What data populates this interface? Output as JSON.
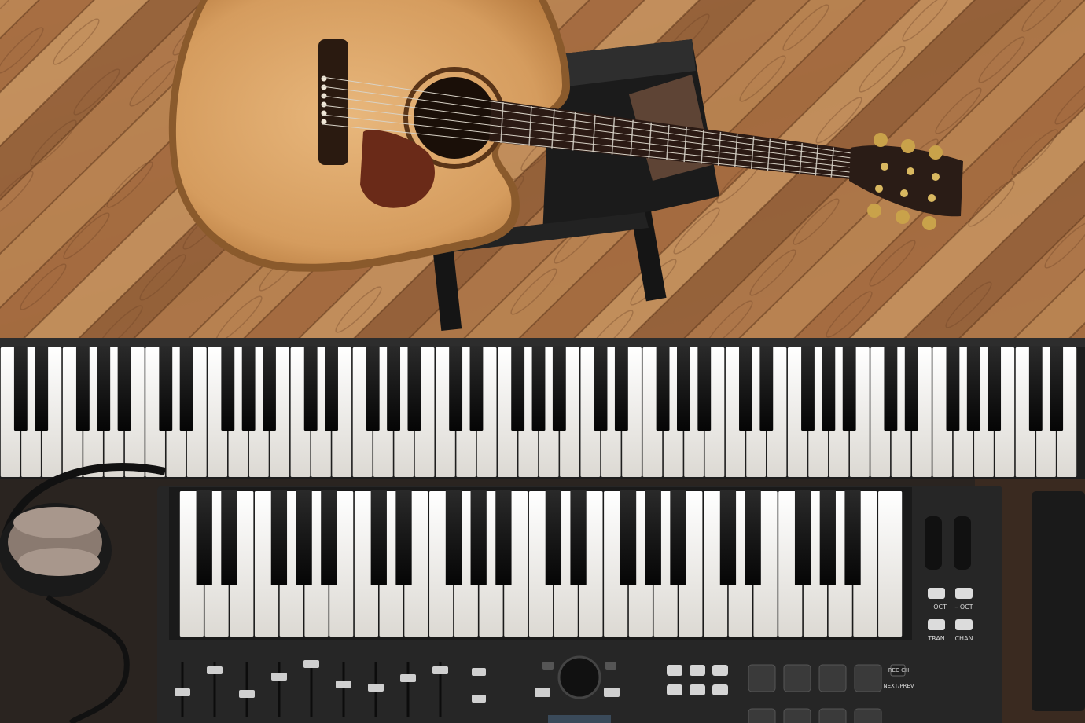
{
  "scene": {
    "description_colors": {
      "floor_light": "#b07a4e",
      "floor_dark": "#6e4226",
      "guitar_top": "#d9a56a",
      "guitar_edge": "#8a5a2c",
      "pickguard": "#6a2a18",
      "fretboard": "#2b1a14",
      "headstock": "#2a1c16",
      "tuners": "#c9a24a",
      "stool": "#1c1c1c",
      "key_white": "#f2f0ec",
      "key_black": "#111111",
      "controller_body": "#262626",
      "desk": "#2a2420"
    },
    "icons": [
      "acoustic-guitar",
      "piano-keyboard",
      "midi-controller",
      "headphones",
      "stool"
    ]
  },
  "controller": {
    "button_labels": [
      "+ OCT",
      "– OCT",
      "TRAN",
      "CHAN"
    ],
    "pad_labels": [
      "REC CH",
      "NEXT/PREV"
    ]
  }
}
